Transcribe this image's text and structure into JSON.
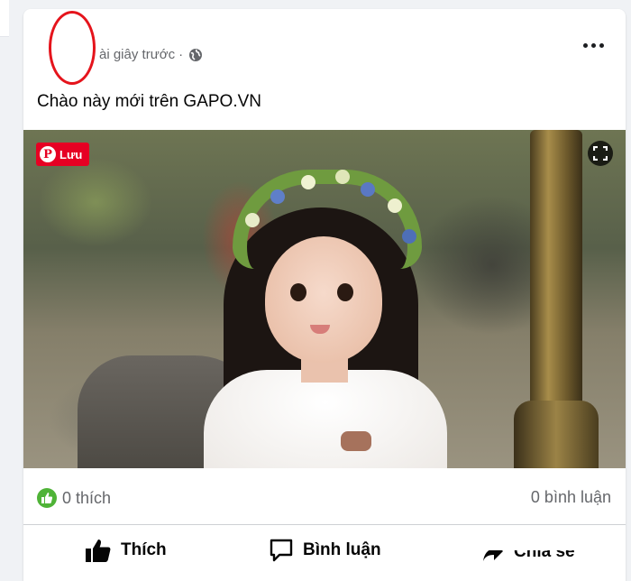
{
  "post": {
    "timestamp": "vài giây trước",
    "timestamp_visible": "ài giây trước",
    "separator": "·",
    "text": "Chào này mới trên GAPO.VN",
    "privacy_icon": "globe-icon",
    "more_icon": "more-dots-icon"
  },
  "image": {
    "save_label": "Lưu",
    "save_icon": "pinterest-icon",
    "expand_icon": "expand-icon"
  },
  "stats": {
    "likes_text": "0 thích",
    "comments_text": "0 bình luận"
  },
  "actions": {
    "like_label": "Thích",
    "comment_label": "Bình luận",
    "share_label": "Chia sẻ"
  },
  "colors": {
    "like_green": "#4fb337",
    "pinterest_red": "#e60023",
    "annotation_red": "#e5141c"
  }
}
